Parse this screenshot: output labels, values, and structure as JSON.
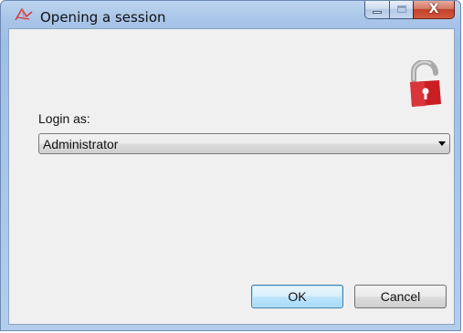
{
  "window": {
    "title": "Opening a session",
    "app_icon": "session-app-icon",
    "caption_buttons": {
      "minimize_icon": "minimize-icon",
      "maximize_icon": "maximize-icon",
      "close_label": "X"
    }
  },
  "form": {
    "lock_icon": "padlock-icon",
    "login_label": "Login as:",
    "login_select": {
      "value": "Administrator",
      "arrow_icon": "dropdown-arrow-icon"
    }
  },
  "buttons": {
    "ok_label": "OK",
    "cancel_label": "Cancel"
  },
  "colors": {
    "frame": "#a9c5e8",
    "client_background": "#f0f0f0",
    "close_button": "#c0412a",
    "lock_body": "#c81e24",
    "default_button_border": "#3c7fb1"
  }
}
